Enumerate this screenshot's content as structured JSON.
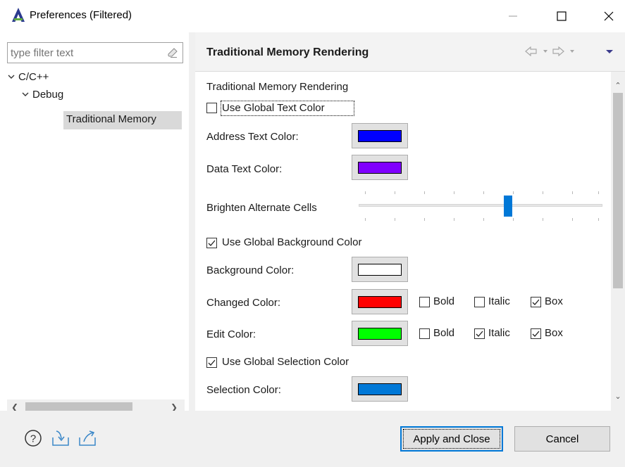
{
  "window": {
    "title": "Preferences (Filtered)",
    "app_icon": "eclipse-logo-icon",
    "controls": [
      "minimize-icon",
      "maximize-icon",
      "close-icon"
    ]
  },
  "left": {
    "filter_placeholder": "type filter text",
    "tree": [
      {
        "label": "C/C++",
        "expanded": true,
        "level": 0
      },
      {
        "label": "Debug",
        "expanded": true,
        "level": 1
      },
      {
        "label": "Traditional Memory",
        "selected": true,
        "level": 2
      }
    ]
  },
  "page": {
    "title": "Traditional Memory Rendering",
    "nav_icons": [
      "back-icon",
      "back-menu-icon",
      "forward-icon",
      "forward-menu-icon",
      "view-menu-icon"
    ],
    "group_label": "Traditional Memory Rendering",
    "use_global_text_color": {
      "label": "Use Global Text Color",
      "checked": false
    },
    "address_text_color": {
      "label": "Address Text Color:",
      "color": "#0000ff"
    },
    "data_text_color": {
      "label": "Data Text Color:",
      "color": "#8000ff"
    },
    "brighten": {
      "label": "Brighten Alternate Cells",
      "level_fraction": 0.61
    },
    "use_global_background_color": {
      "label": "Use Global Background Color",
      "checked": true
    },
    "background_color": {
      "label": "Background Color:",
      "color": "#ffffff"
    },
    "changed_color": {
      "label": "Changed Color:",
      "color": "#ff0000",
      "bold": {
        "label": "Bold",
        "checked": false
      },
      "italic": {
        "label": "Italic",
        "checked": false
      },
      "box": {
        "label": "Box",
        "checked": true
      }
    },
    "edit_color": {
      "label": "Edit Color:",
      "color": "#00ff00",
      "bold": {
        "label": "Bold",
        "checked": false
      },
      "italic": {
        "label": "Italic",
        "checked": true
      },
      "box": {
        "label": "Box",
        "checked": true
      }
    },
    "use_global_selection_color": {
      "label": "Use Global Selection Color",
      "checked": true
    },
    "selection_color": {
      "label": "Selection Color:",
      "color": "#0078d7"
    }
  },
  "footer": {
    "icons": [
      "help-icon",
      "import-icon",
      "export-icon"
    ],
    "apply_close": "Apply and Close",
    "cancel": "Cancel"
  }
}
